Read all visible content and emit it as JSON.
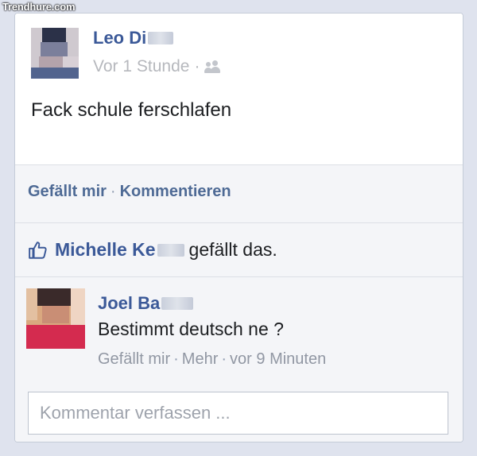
{
  "watermark": "Trendhure.com",
  "post": {
    "author": "Leo Di",
    "time": "Vor 1 Stunde",
    "meta_separator": "·",
    "privacy_icon": "friends-icon",
    "text": "Fack schule ferschlafen"
  },
  "actions": {
    "like_label": "Gefällt mir",
    "separator": "·",
    "comment_label": "Kommentieren"
  },
  "likes": {
    "icon": "thumbs-up-icon",
    "liker": "Michelle Ke",
    "suffix": "gefällt das."
  },
  "comment": {
    "author": "Joel Ba",
    "text": "Bestimmt deutsch ne ?",
    "like_label": "Gefällt mir",
    "more_label": "Mehr",
    "time": "vor 9 Minuten",
    "separator": "·"
  },
  "composer": {
    "placeholder": "Kommentar verfassen ..."
  },
  "colors": {
    "link": "#3b5998",
    "background": "#dfe3ee",
    "panel": "#f4f5f8"
  }
}
